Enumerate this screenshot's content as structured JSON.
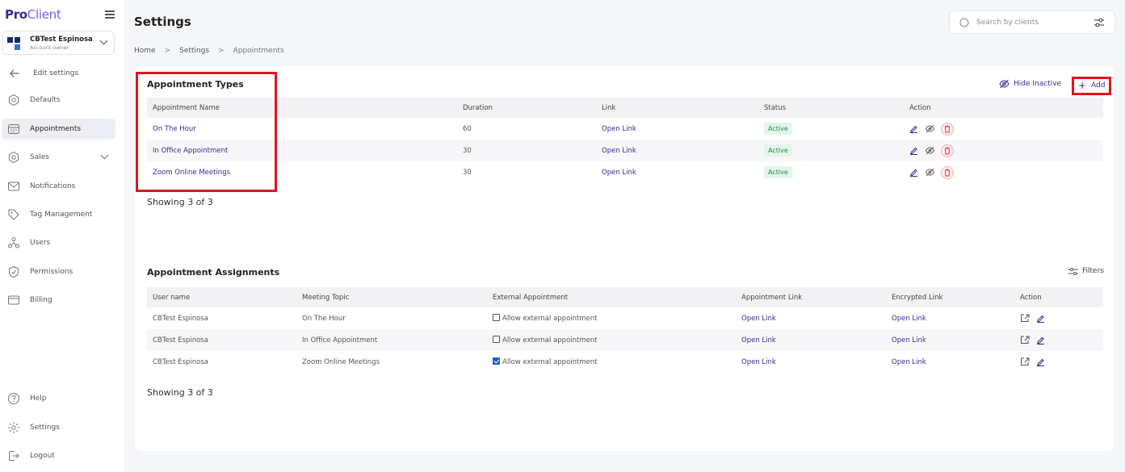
{
  "brand": {
    "pro": "Pro",
    "client": "Client"
  },
  "account": {
    "name": "CBTest Espinosa",
    "role": "Account owner"
  },
  "sidebar": {
    "back_label": "Edit settings",
    "items": [
      {
        "label": "Defaults",
        "icon": "gear-icon"
      },
      {
        "label": "Appointments",
        "icon": "calendar-icon",
        "active": true
      },
      {
        "label": "Sales",
        "icon": "gear-icon"
      },
      {
        "label": "Notifications",
        "icon": "envelope-icon"
      },
      {
        "label": "Tag Management",
        "icon": "tag-icon"
      },
      {
        "label": "Users",
        "icon": "users-icon"
      },
      {
        "label": "Permissions",
        "icon": "shield-icon"
      },
      {
        "label": "Billing",
        "icon": "card-icon"
      }
    ],
    "bottom": [
      {
        "label": "Help",
        "icon": "help-icon"
      },
      {
        "label": "Settings",
        "icon": "gear-icon"
      },
      {
        "label": "Logout",
        "icon": "logout-icon"
      }
    ]
  },
  "header": {
    "title": "Settings"
  },
  "search": {
    "placeholder": "Search by clients"
  },
  "breadcrumb": {
    "home": "Home",
    "settings": "Settings",
    "current": "Appointments",
    "sep": ">"
  },
  "appointment_types": {
    "title": "Appointment Types",
    "hide_inactive_label": "Hide Inactive",
    "add_label": "Add",
    "columns": [
      "Appointment Name",
      "Duration",
      "Link",
      "Status",
      "Action"
    ],
    "rows": [
      {
        "name": "On The Hour",
        "duration": "60",
        "link": "Open Link",
        "status": "Active"
      },
      {
        "name": "In Office Appointment",
        "duration": "30",
        "link": "Open Link",
        "status": "Active"
      },
      {
        "name": "Zoom Online Meetings",
        "duration": "30",
        "link": "Open Link",
        "status": "Active"
      }
    ],
    "showing": "Showing 3 of 3"
  },
  "appointment_assignments": {
    "title": "Appointment Assignments",
    "filters_label": "Filters",
    "columns": [
      "User name",
      "Meeting Topic",
      "External Appointment",
      "Appointment Link",
      "Encrypted Link",
      "Action"
    ],
    "rows": [
      {
        "user": "CBTest Espinosa",
        "topic": "On The Hour",
        "external_label": "Allow external appointment",
        "external_checked": false,
        "appointment_link": "Open Link",
        "encrypted_link": "Open Link"
      },
      {
        "user": "CBTest Espinosa",
        "topic": "In Office Appointment",
        "external_label": "Allow external appointment",
        "external_checked": false,
        "appointment_link": "Open Link",
        "encrypted_link": "Open Link"
      },
      {
        "user": "CBTest Espinosa",
        "topic": "Zoom Online Meetings",
        "external_label": "Allow external appointment",
        "external_checked": true,
        "appointment_link": "Open Link",
        "encrypted_link": "Open Link"
      }
    ],
    "showing": "Showing 3 of 3"
  },
  "colors": {
    "accent": "#3d2a8c",
    "highlight": "#e0141e",
    "active_badge": "#1e8a4c"
  }
}
